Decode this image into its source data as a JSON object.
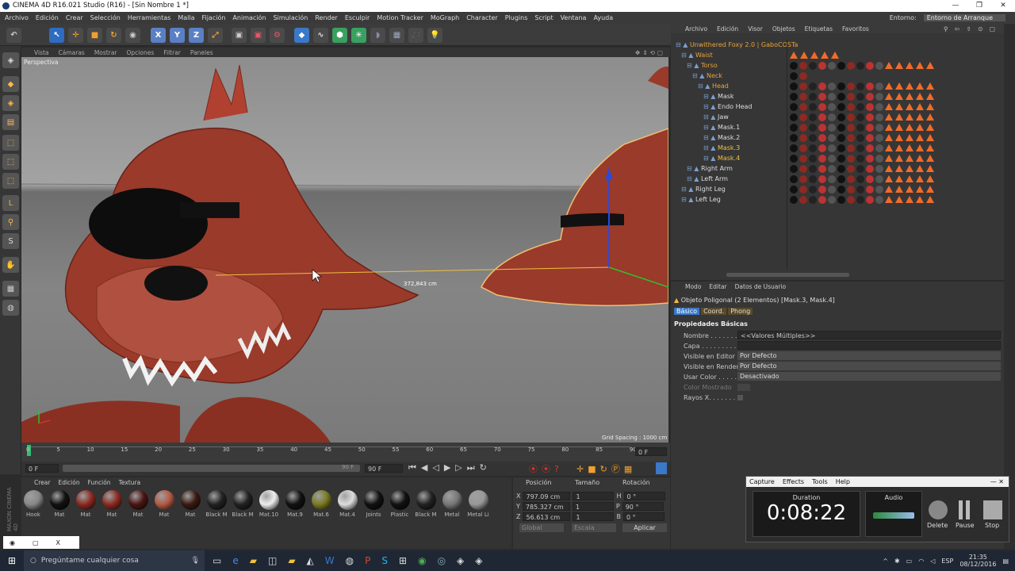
{
  "titlebar": {
    "title": "CINEMA 4D R16.021 Studio (R16) - [Sin Nombre 1 *]",
    "min": "—",
    "max": "❐",
    "close": "✕"
  },
  "menu": [
    "Archivo",
    "Edición",
    "Crear",
    "Selección",
    "Herramientas",
    "Malla",
    "Fijación",
    "Animación",
    "Simulación",
    "Render",
    "Esculpir",
    "Motion Tracker",
    "MoGraph",
    "Character",
    "Plugins",
    "Script",
    "Ventana",
    "Ayuda"
  ],
  "layout": {
    "label": "Entorno:",
    "value": "Entorno de Arranque"
  },
  "viewport": {
    "menu": [
      "Vista",
      "Cámaras",
      "Mostrar",
      "Opciones",
      "Filtrar",
      "Paneles"
    ],
    "name": "Perspectiva",
    "measure": "372,843 cm",
    "grid": "Grid Spacing : 1000 cm"
  },
  "timeline": {
    "ticks": [
      "0",
      "5",
      "10",
      "15",
      "20",
      "25",
      "30",
      "35",
      "40",
      "45",
      "50",
      "55",
      "60",
      "65",
      "70",
      "75",
      "80",
      "85",
      "90"
    ],
    "end": "0 F"
  },
  "playbar": {
    "start": "0 F",
    "end": "90 F",
    "max": "90 F"
  },
  "materials": {
    "menu": [
      "Crear",
      "Edición",
      "Función",
      "Textura"
    ],
    "items": [
      {
        "name": "Hook",
        "color": "#888"
      },
      {
        "name": "Mat",
        "color": "#111"
      },
      {
        "name": "Mat",
        "color": "#8b2a22"
      },
      {
        "name": "Mat",
        "color": "#8b2a22"
      },
      {
        "name": "Mat",
        "color": "#4a1512"
      },
      {
        "name": "Mat",
        "color": "#b35a45"
      },
      {
        "name": "Mat",
        "color": "#3a1a12"
      },
      {
        "name": "Black M",
        "color": "#222"
      },
      {
        "name": "Black M",
        "color": "#222"
      },
      {
        "name": "Mat.10",
        "color": "#eee"
      },
      {
        "name": "Mat.9",
        "color": "#111"
      },
      {
        "name": "Mat.6",
        "color": "#7a7a22"
      },
      {
        "name": "Mat.4",
        "color": "#ddd"
      },
      {
        "name": "Joints",
        "color": "#111"
      },
      {
        "name": "Plastic",
        "color": "#111"
      },
      {
        "name": "Black M",
        "color": "#222"
      },
      {
        "name": "Metal",
        "color": "#777"
      },
      {
        "name": "Metal Li",
        "color": "#999"
      }
    ]
  },
  "coords": {
    "headers": [
      "Posición",
      "Tamaño",
      "Rotación"
    ],
    "rows": [
      {
        "a": "X",
        "pos": "797.09 cm",
        "sz": "1",
        "b": "H",
        "rot": "0 °"
      },
      {
        "a": "Y",
        "pos": "785.327 cm",
        "sz": "1",
        "b": "P",
        "rot": "90 °"
      },
      {
        "a": "Z",
        "pos": "56.613 cm",
        "sz": "1",
        "b": "B",
        "rot": "0 °"
      }
    ],
    "mode": "Global",
    "scale": "Escala",
    "apply": "Aplicar"
  },
  "objmgr": {
    "menu": [
      "Archivo",
      "Edición",
      "Visor",
      "Objetos",
      "Etiquetas",
      "Favoritos"
    ],
    "items": [
      {
        "name": "Unwithered Foxy 2.0 | GaboCOSTa",
        "indent": 0,
        "color": "#e8a33a"
      },
      {
        "name": "Waist",
        "indent": 1,
        "color": "#e8a33a"
      },
      {
        "name": "Torso",
        "indent": 2,
        "color": "#e8a33a"
      },
      {
        "name": "Neck",
        "indent": 3,
        "color": "#e8a33a"
      },
      {
        "name": "Head",
        "indent": 4,
        "color": "#e8a33a"
      },
      {
        "name": "Mask",
        "indent": 5,
        "color": "#ddd"
      },
      {
        "name": "Endo Head",
        "indent": 5,
        "color": "#ddd"
      },
      {
        "name": "Jaw",
        "indent": 5,
        "color": "#ddd"
      },
      {
        "name": "Mask.1",
        "indent": 5,
        "color": "#ddd"
      },
      {
        "name": "Mask.2",
        "indent": 5,
        "color": "#ddd"
      },
      {
        "name": "Mask.3",
        "indent": 5,
        "color": "#f0c040"
      },
      {
        "name": "Mask.4",
        "indent": 5,
        "color": "#f0c040"
      },
      {
        "name": "Right Arm",
        "indent": 2,
        "color": "#ddd"
      },
      {
        "name": "Left Arm",
        "indent": 2,
        "color": "#ddd"
      },
      {
        "name": "Right Leg",
        "indent": 1,
        "color": "#ddd"
      },
      {
        "name": "Left Leg",
        "indent": 1,
        "color": "#ddd"
      }
    ]
  },
  "attr": {
    "menu": [
      "Modo",
      "Editar",
      "Datos de Usuario"
    ],
    "object": "Objeto Poligonal (2 Elementos) [Mask.3, Mask.4]",
    "tabs": [
      "Básico",
      "Coord.",
      "Phong"
    ],
    "section": "Propiedades Básicas",
    "fields": [
      {
        "label": "Nombre . . . . . . . . . .",
        "value": "<<Valores Múltiples>>"
      },
      {
        "label": "Capa . . . . . . . . . . . .",
        "value": ""
      },
      {
        "label": "Visible en Editor",
        "value": "Por Defecto"
      },
      {
        "label": "Visible en Render",
        "value": "Por Defecto"
      },
      {
        "label": "Usar Color . . . . . .",
        "value": "Desactivado"
      },
      {
        "label": "Color Mostrado",
        "value": ""
      },
      {
        "label": "Rayos X. . . . . . . .",
        "value": ""
      }
    ]
  },
  "recorder": {
    "menu": [
      "Capture",
      "Effects",
      "Tools",
      "Help"
    ],
    "duration_label": "Duration",
    "time": "0:08:22",
    "audio_label": "Audio",
    "buttons": [
      "Delete",
      "Pause",
      "Stop"
    ]
  },
  "taskbar": {
    "search": "Pregúntame cualquier cosa",
    "lang": "ESP",
    "time": "21:35",
    "date": "08/12/2016"
  },
  "bottomtab": "X",
  "logo": "MAXON CINEMA 4D"
}
